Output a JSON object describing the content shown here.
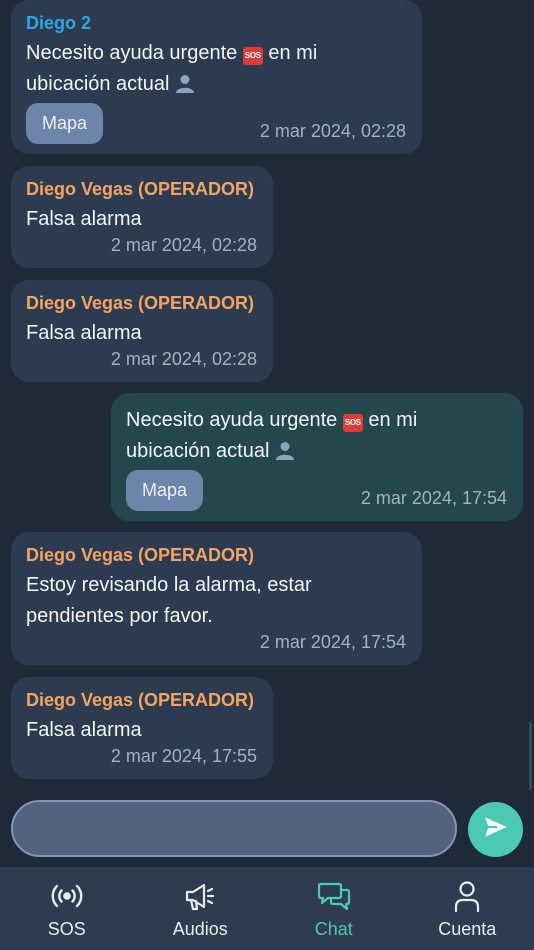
{
  "messages": [
    {
      "sender": "Diego 2",
      "text_before": "Necesito ayuda urgente",
      "text_mid": "en mi",
      "text_line2": "ubicación actual",
      "sos_badge": "SOS",
      "map_label": "Mapa",
      "time": "2 mar 2024, 02:28"
    },
    {
      "sender": "Diego Vegas (OPERADOR)",
      "text": "Falsa alarma",
      "time": "2 mar 2024, 02:28"
    },
    {
      "sender": "Diego Vegas (OPERADOR)",
      "text": "Falsa alarma",
      "time": "2 mar 2024, 02:28"
    },
    {
      "text_before": "Necesito ayuda urgente",
      "text_mid": "en mi",
      "text_line2": "ubicación actual",
      "sos_badge": "SOS",
      "map_label": "Mapa",
      "time": "2 mar 2024, 17:54"
    },
    {
      "sender": "Diego Vegas (OPERADOR)",
      "text_line1": "Estoy revisando la alarma, estar",
      "text_line2": "pendientes por favor.",
      "time": "2 mar 2024, 17:54"
    },
    {
      "sender": "Diego Vegas (OPERADOR)",
      "text": "Falsa alarma",
      "time": "2 mar 2024, 17:55"
    }
  ],
  "composer": {
    "value": ""
  },
  "tabs": [
    {
      "label": "SOS",
      "icon": "broadcast-icon",
      "active": false
    },
    {
      "label": "Audios",
      "icon": "megaphone-icon",
      "active": false
    },
    {
      "label": "Chat",
      "icon": "chat-icon",
      "active": true
    },
    {
      "label": "Cuenta",
      "icon": "user-icon",
      "active": false
    }
  ],
  "colors": {
    "background": "#1e2a38",
    "bubble": "#2d3b50",
    "bubble_mine": "#23474b",
    "accent": "#4cc9b4",
    "user_name": "#2aa8e6",
    "operator_name": "#f4a462"
  }
}
